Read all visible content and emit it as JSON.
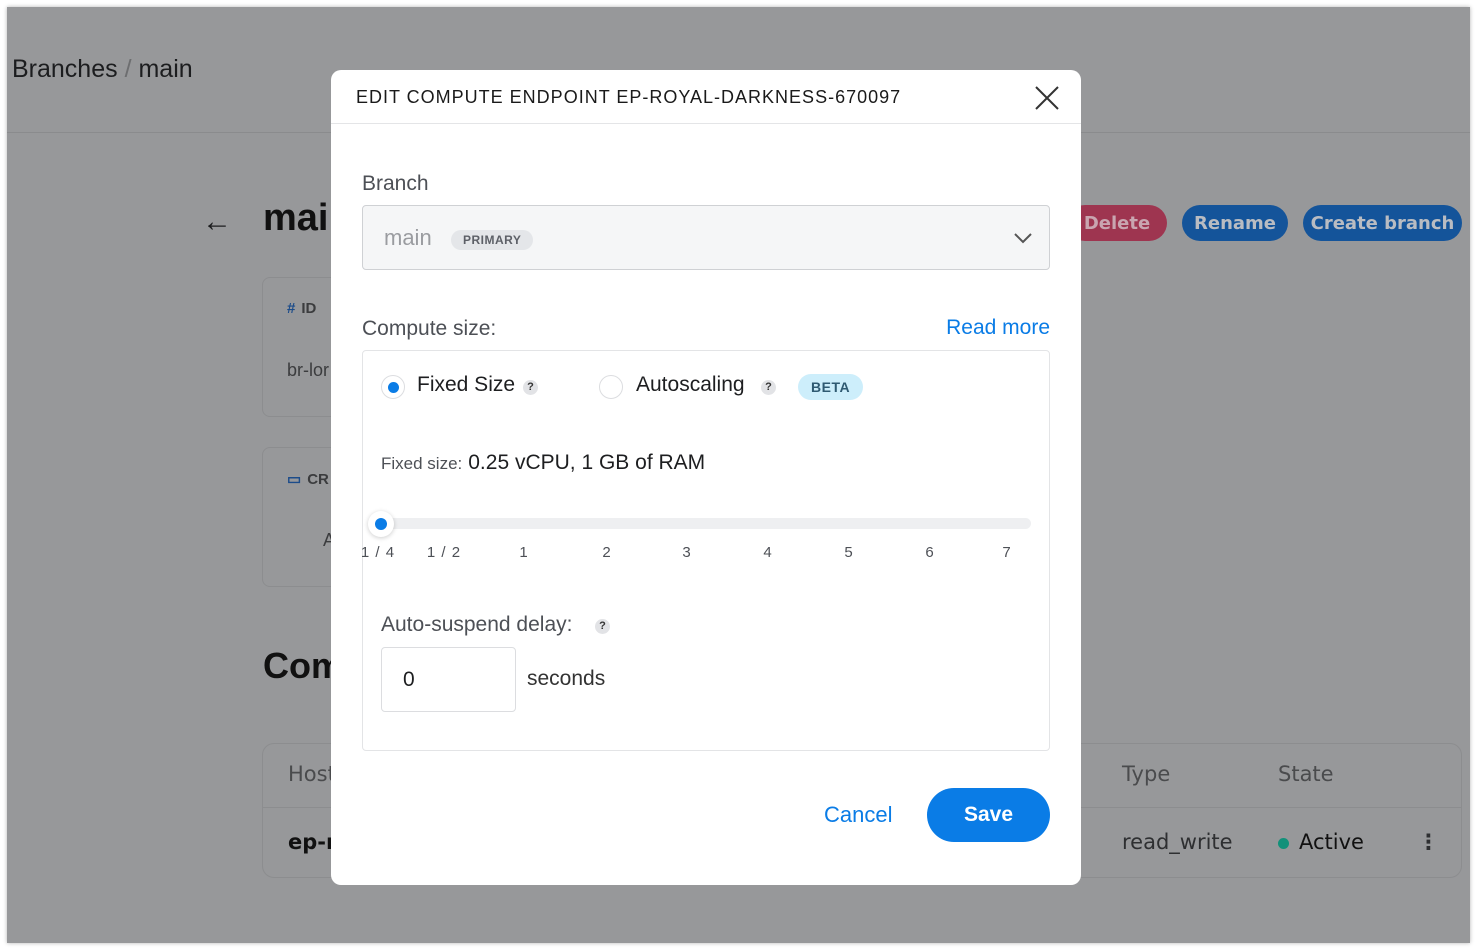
{
  "breadcrumb": {
    "parent": "Branches",
    "separator": "/",
    "current": "main"
  },
  "page": {
    "title": "main",
    "back_icon": "arrow-left-icon"
  },
  "actions": {
    "delete": "Delete",
    "rename": "Rename",
    "create_branch": "Create branch"
  },
  "colors": {
    "accent": "#0a7ce6",
    "delete": "#9e3550",
    "dim_button": "#14549a",
    "active": "#12917a"
  },
  "cards": [
    {
      "icon": "hash-icon",
      "label": "ID",
      "value": "br-lor"
    },
    {
      "icon": "calendar-icon",
      "label": "CR",
      "value": "A"
    }
  ],
  "section": {
    "title": "Com"
  },
  "table": {
    "headers": [
      "Host",
      "Type",
      "State"
    ],
    "rows": [
      {
        "host": "ep-r",
        "type": "read_write",
        "state": "Active"
      }
    ]
  },
  "modal": {
    "title": "EDIT COMPUTE ENDPOINT EP-ROYAL-DARKNESS-670097",
    "branch_label": "Branch",
    "branch_value": "main",
    "branch_badge": "PRIMARY",
    "compute_label": "Compute size:",
    "read_more": "Read more",
    "options": [
      {
        "label": "Fixed Size",
        "selected": true
      },
      {
        "label": "Autoscaling",
        "selected": false,
        "badge": "BETA"
      }
    ],
    "help": "?",
    "fixed_label": "Fixed size:",
    "fixed_value": "0.25 vCPU, 1 GB of RAM",
    "slider": {
      "value": 0.25,
      "ticks": [
        "1 / 4",
        "1 / 2",
        "1",
        "2",
        "3",
        "4",
        "5",
        "6",
        "7"
      ]
    },
    "suspend_label": "Auto-suspend delay:",
    "suspend_value": "0",
    "suspend_unit": "seconds",
    "cancel": "Cancel",
    "save": "Save"
  }
}
